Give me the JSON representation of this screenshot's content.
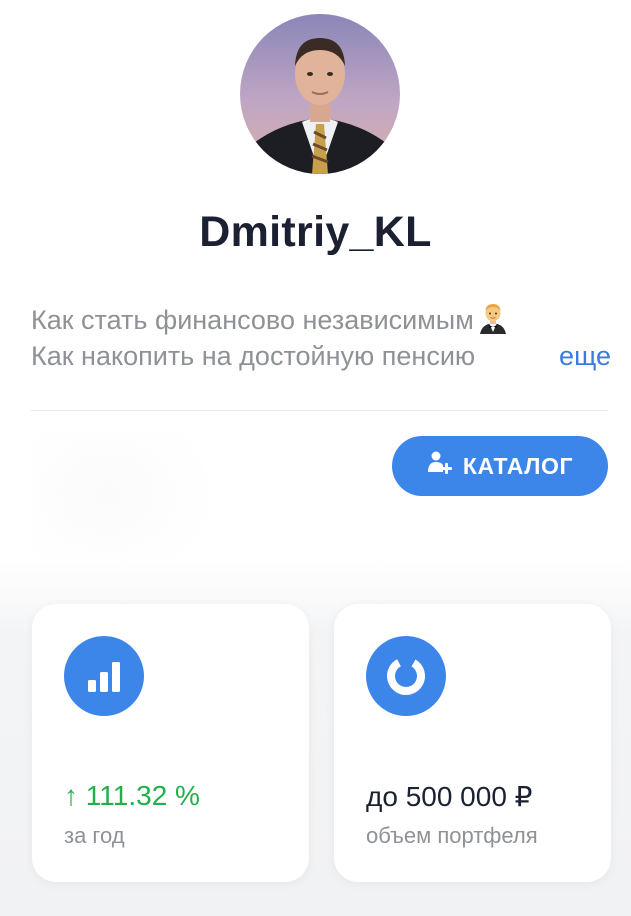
{
  "profile": {
    "username": "Dmitriy_KL",
    "bio_line1": "Как стать финансово независимым",
    "bio_line2": "Как накопить на достойную пенсию",
    "more_label": "еще"
  },
  "catalog_button": {
    "label": "КАТАЛОГ"
  },
  "stats": [
    {
      "value": "↑ 111.32 %",
      "caption": "за год",
      "icon": "bar-chart-icon",
      "tone": "positive"
    },
    {
      "value": "до 500 000 ₽",
      "caption": "объем портфеля",
      "icon": "donut-chart-icon",
      "tone": "neutral"
    }
  ],
  "colors": {
    "accent": "#3d86e9",
    "positive": "#21b04b",
    "text_primary": "#1b2133",
    "text_secondary": "#8e9297",
    "link": "#3a7be0"
  }
}
